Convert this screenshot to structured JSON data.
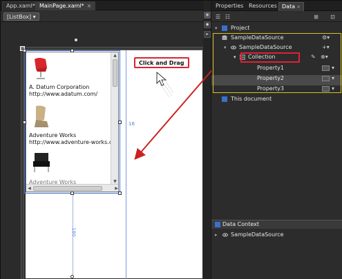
{
  "designer": {
    "tabs": [
      {
        "label": "App.xaml*",
        "close": "×"
      },
      {
        "label": "MainPage.xaml*",
        "close": "×"
      }
    ],
    "breadcrumb": "[ListBox] ▾",
    "listbox": {
      "items": [
        {
          "name": "A. Datum Corporation",
          "url": "http://www.adatum.com/"
        },
        {
          "name": "Adventure Works",
          "url": "http://www.adventure-works.co"
        },
        {
          "name": "Adventure Works"
        }
      ]
    },
    "callout": "Click and Drag",
    "measure_width": "16",
    "measure_height": "180",
    "colors": {
      "selection": "#3b6fd0",
      "callout_border": "#dd2233",
      "arrow": "#cc2222"
    }
  },
  "panel": {
    "tabs": [
      "Properties",
      "Resources",
      "Data"
    ],
    "active_tab": "Data",
    "tab_close": "×",
    "tree": {
      "project": "Project",
      "datasource": "SampleDataSource",
      "datasource_child": "SampleDataSource",
      "collection": "Collection",
      "properties": [
        "Property1",
        "Property2",
        "Property3"
      ],
      "document": "This document"
    },
    "data_context": {
      "header": "Data Context",
      "item": "SampleDataSource"
    },
    "colors": {
      "yellow_outline": "#d9c32a",
      "red_outline": "#dd2233"
    }
  }
}
